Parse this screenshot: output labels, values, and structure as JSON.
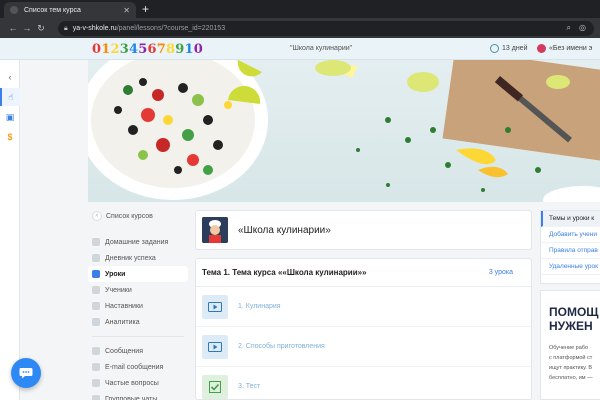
{
  "browser": {
    "tab_title": "Список тем курса",
    "url_host": "ya-v-shkole.ru",
    "url_path": "/panel/lessons/?course_id=220153"
  },
  "header": {
    "logo_digits": [
      "0",
      "1",
      "2",
      "3",
      "4",
      "5",
      "6",
      "7",
      "8",
      "9",
      "1",
      "0"
    ],
    "logo_colors": [
      "#e53935",
      "#fb8c00",
      "#fdd835",
      "#43a047",
      "#1e88e5",
      "#8e24aa",
      "#e53935",
      "#fb8c00",
      "#fdd835",
      "#43a047",
      "#1e88e5",
      "#8e24aa"
    ],
    "course_name": "\"Школа кулинарии\"",
    "days": "13 дней",
    "user": "«Без имени э"
  },
  "sidebar": {
    "back": "Список курсов",
    "items": [
      {
        "label": "Домашние задания"
      },
      {
        "label": "Дневник успеха"
      },
      {
        "label": "Уроки",
        "active": true
      },
      {
        "label": "Ученики"
      },
      {
        "label": "Наставники"
      },
      {
        "label": "Аналитика"
      }
    ],
    "items2": [
      {
        "label": "Сообщения"
      },
      {
        "label": "E-mail сообщения"
      },
      {
        "label": "Частые вопросы"
      },
      {
        "label": "Групповые чаты"
      }
    ]
  },
  "course": {
    "title": "«Школа кулинарии»"
  },
  "topic": {
    "title": "Тема 1. Тема курса ««Школа кулинарии»»",
    "count": "3 урока",
    "lessons": [
      {
        "name": "1. Кулинария",
        "kind": "video"
      },
      {
        "name": "2. Способы приготовления",
        "kind": "video"
      },
      {
        "name": "3. Тест",
        "kind": "test"
      }
    ]
  },
  "right_menu": {
    "items": [
      "Темы и уроки к",
      "Добавить учени",
      "Правила отправ",
      "Удаленные урок"
    ]
  },
  "help": {
    "title_1": "ПОМОЩ",
    "title_2": "НУЖЕН",
    "lines": [
      "Обучение рабо",
      "с платформой ст",
      "ищут практику. В",
      "бесплатно, им —"
    ]
  },
  "colors": {
    "accent": "#3b7fe8",
    "header_bg": "#e9f3f8",
    "chat_button": "#2f89f5"
  }
}
